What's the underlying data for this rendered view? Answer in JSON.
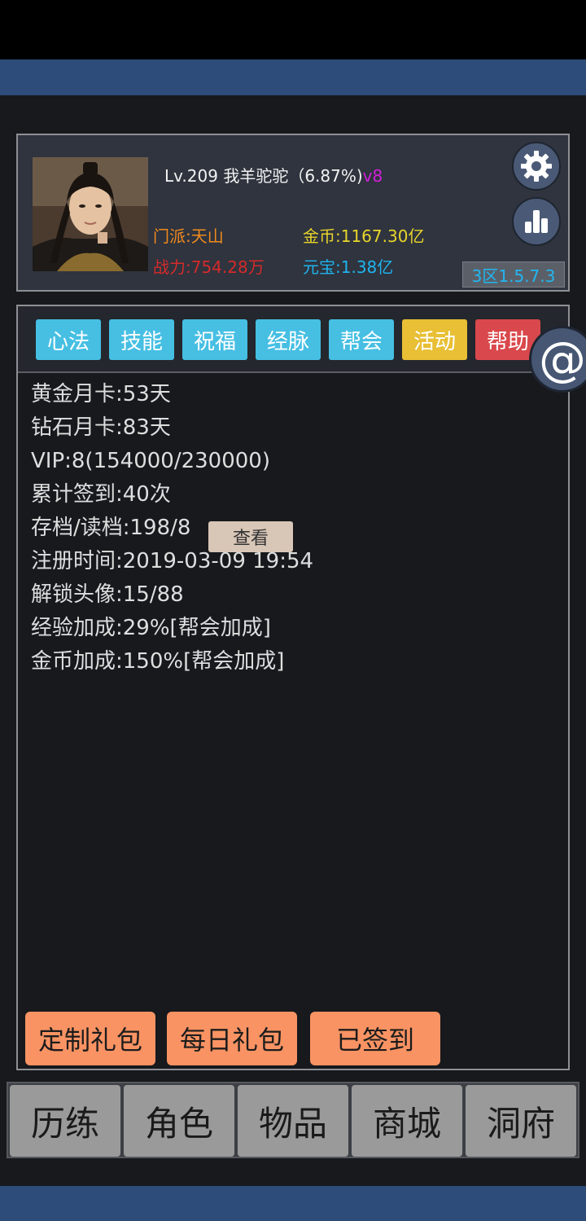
{
  "profile": {
    "level_text": "Lv.209 我羊驼驼（6.87%)",
    "vip_tag": "v8",
    "sect": "门派:天山",
    "power": "战力:754.28万",
    "gold": "金币:1167.30亿",
    "yuanbao": "元宝:1.38亿",
    "server": "3区1.5.7.3"
  },
  "tabs": [
    {
      "label": "心法",
      "color": "#46bfe3"
    },
    {
      "label": "技能",
      "color": "#46bfe3"
    },
    {
      "label": "祝福",
      "color": "#46bfe3"
    },
    {
      "label": "经脉",
      "color": "#46bfe3"
    },
    {
      "label": "帮会",
      "color": "#46bfe3"
    },
    {
      "label": "活动",
      "color": "#e8bf35"
    },
    {
      "label": "帮助",
      "color": "#d9484c"
    }
  ],
  "info": [
    "黄金月卡:53天",
    "钻石月卡:83天",
    "VIP:8(154000/230000)",
    "累计签到:40次",
    "存档/读档:198/8",
    "注册时间:2019-03-09 19:54",
    "解锁头像:15/88",
    "经验加成:29%[帮会加成]",
    "金币加成:150%[帮会加成]"
  ],
  "view_button": "查看",
  "gifts": {
    "custom": "定制礼包",
    "daily": "每日礼包",
    "signed": "已签到"
  },
  "at_symbol": "@",
  "nav": [
    "历练",
    "角色",
    "物品",
    "商城",
    "洞府"
  ],
  "icons": {
    "settings": "gear-icon",
    "stats": "bar-chart-icon",
    "at": "at-icon"
  }
}
